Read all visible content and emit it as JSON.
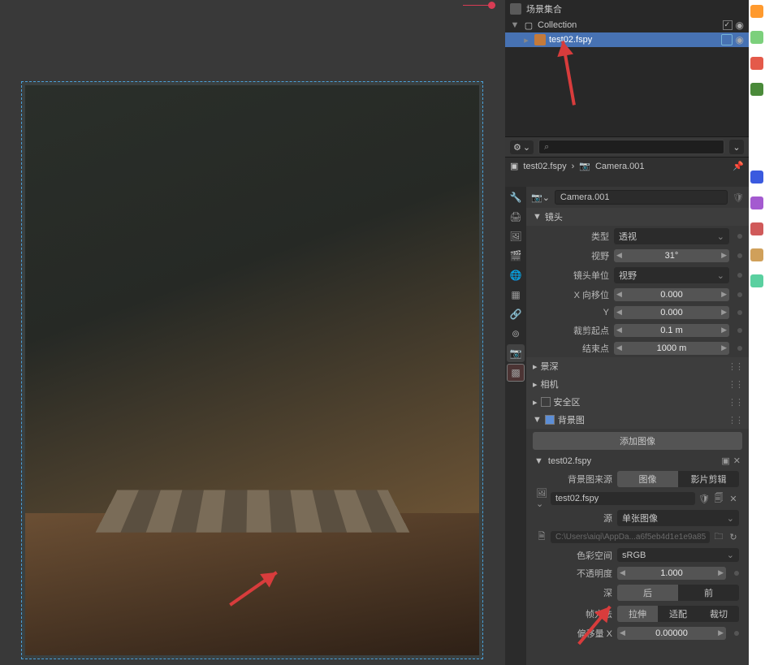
{
  "outliner": {
    "header": "场景集合",
    "collection": "Collection",
    "item": "test02.fspy"
  },
  "crumb": {
    "scene": "test02.fspy",
    "object": "Camera.001"
  },
  "camera_selector": "Camera.001",
  "panels": {
    "lens": "镜头",
    "dof": "景深",
    "camera": "相机",
    "safe": "安全区",
    "bg": "背景图"
  },
  "lens": {
    "type_lbl": "类型",
    "type_val": "透视",
    "fov_lbl": "视野",
    "fov_val": "31°",
    "unit_lbl": "镜头单位",
    "unit_val": "视野",
    "shiftx_lbl": "X 向移位",
    "shiftx_val": "0.000",
    "shifty_lbl": "Y",
    "shifty_val": "0.000",
    "clipstart_lbl": "裁剪起点",
    "clipstart_val": "0.1 m",
    "clipend_lbl": "结束点",
    "clipend_val": "1000 m"
  },
  "bg": {
    "add_btn": "添加图像",
    "item_name": "test02.fspy",
    "source_lbl": "背景图来源",
    "source_img": "图像",
    "source_clip": "影片剪辑",
    "img_name": "test02.fspy",
    "src_lbl": "源",
    "src_val": "单张图像",
    "path": "C:\\Users\\aiqi\\AppDa...a6f5eb4d1e1e9a85",
    "colorspace_lbl": "色彩空间",
    "colorspace_val": "sRGB",
    "opacity_lbl": "不透明度",
    "opacity_val": "1.000",
    "depth_lbl": "深",
    "depth_back": "后",
    "depth_front": "前",
    "frame_lbl": "帧方法",
    "frame_stretch": "拉伸",
    "frame_fit": "适配",
    "frame_crop": "裁切",
    "offset_lbl": "偏移量 X",
    "offset_val": "0.00000"
  }
}
